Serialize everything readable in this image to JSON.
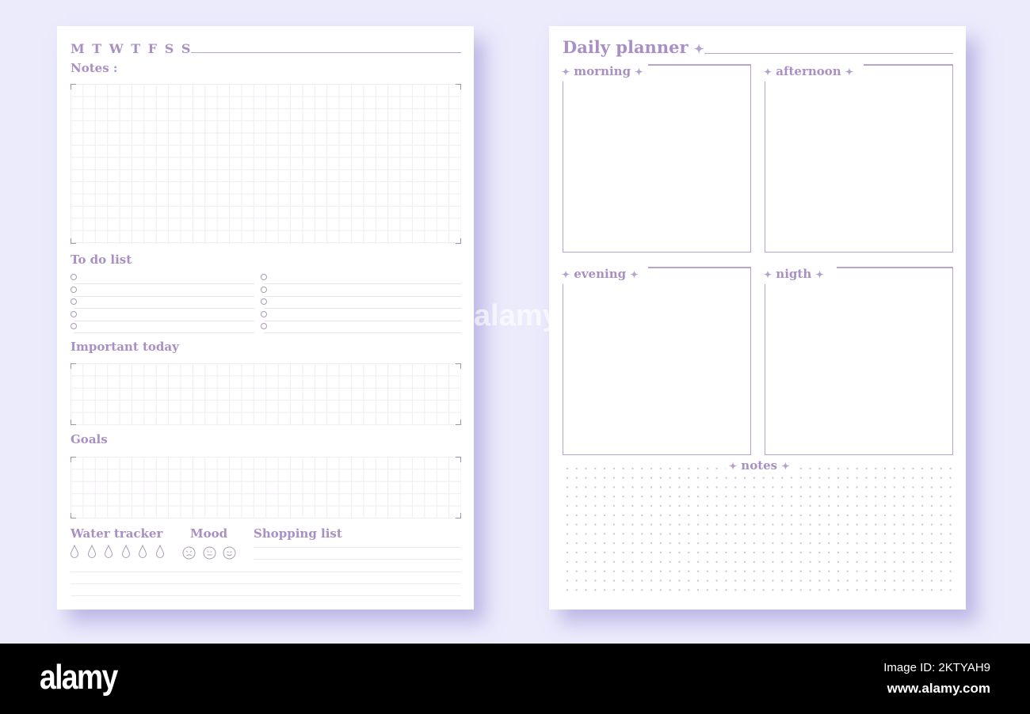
{
  "left_page": {
    "weekdays": "M T W T F S S",
    "notes_label": "Notes :",
    "todo_label": "To do list",
    "todo_items_per_column": 5,
    "important_label": "Important today",
    "goals_label": "Goals",
    "water_label": "Water tracker",
    "water_drops": 6,
    "mood_label": "Mood",
    "mood_icons": [
      "angry-face-icon",
      "neutral-face-icon",
      "happy-face-icon"
    ],
    "shopping_label": "Shopping list"
  },
  "right_page": {
    "title": "Daily planner",
    "sections": [
      {
        "label": "morning"
      },
      {
        "label": "afternoon"
      },
      {
        "label": "evening"
      },
      {
        "label": "nigth"
      }
    ],
    "notes_label": "notes"
  },
  "footer": {
    "logo": "alamy",
    "image_id": "Image ID: 2KTYAH9",
    "site": "www.alamy.com"
  },
  "colors": {
    "background": "#ecebfc",
    "accent": "#a98fc4",
    "line": "#b7a3cf",
    "grid": "#f1ebf3"
  }
}
